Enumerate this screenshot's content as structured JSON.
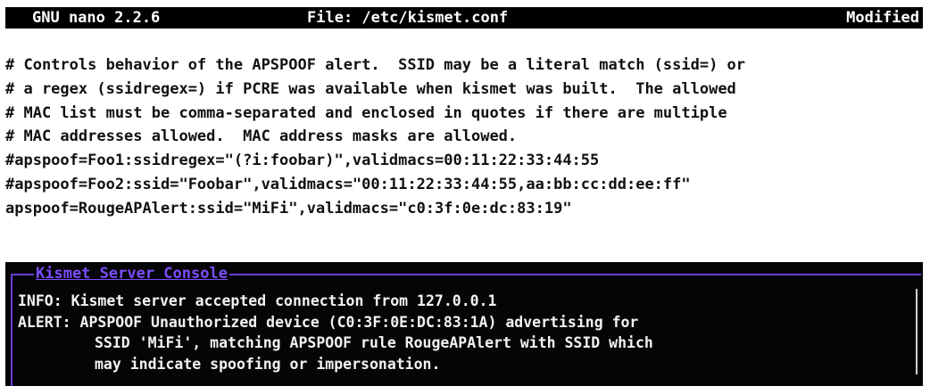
{
  "titlebar": {
    "app": "GNU nano 2.2.6",
    "file": "File: /etc/kismet.conf",
    "status": "Modified"
  },
  "editor": {
    "lines": [
      "# Controls behavior of the APSPOOF alert.  SSID may be a literal match (ssid=) or",
      "# a regex (ssidregex=) if PCRE was available when kismet was built.  The allowed",
      "# MAC list must be comma-separated and enclosed in quotes if there are multiple",
      "# MAC addresses allowed.  MAC address masks are allowed.",
      "#apspoof=Foo1:ssidregex=\"(?i:foobar)\",validmacs=00:11:22:33:44:55",
      "#apspoof=Foo2:ssid=\"Foobar\",validmacs=\"00:11:22:33:44:55,aa:bb:cc:dd:ee:ff\"",
      "apspoof=RougeAPAlert:ssid=\"MiFi\",validmacs=\"c0:3f:0e:dc:83:19\"",
      ""
    ]
  },
  "console": {
    "title": "Kismet Server Console",
    "messages": [
      "INFO: Kismet server accepted connection from 127.0.0.1",
      "ALERT: APSPOOF Unauthorized device (C0:3F:0E:DC:83:1A) advertising for",
      "SSID 'MiFi', matching APSPOOF rule RougeAPAlert with SSID which",
      "may indicate spoofing or impersonation."
    ]
  },
  "colors": {
    "console_border": "#6a3fd6",
    "console_title": "#7b4dff",
    "console_background": "#050505",
    "titlebar_background": "#000000"
  }
}
